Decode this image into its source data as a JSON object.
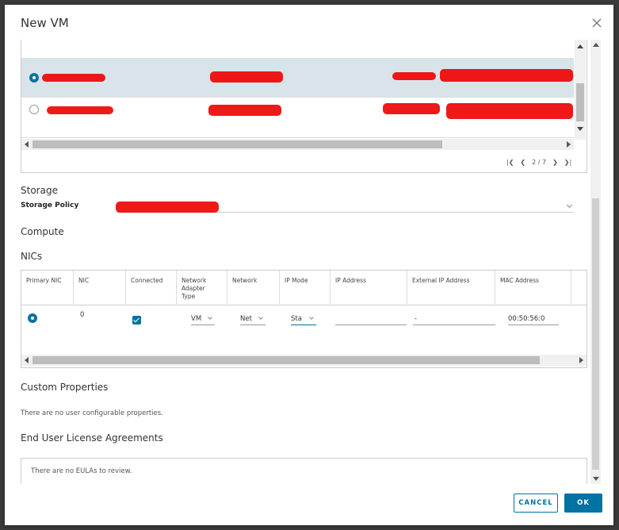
{
  "dialog": {
    "title": "New VM"
  },
  "image_grid": {
    "rows": [
      {
        "selected": true
      },
      {
        "selected": false
      }
    ],
    "pager": {
      "page": "2 / 7"
    }
  },
  "storage": {
    "title": "Storage",
    "policy_label": "Storage Policy"
  },
  "compute": {
    "title": "Compute"
  },
  "nics": {
    "title": "NICs",
    "columns": [
      "Primary NIC",
      "NIC",
      "Connected",
      "Network Adapter Type",
      "Network",
      "IP Mode",
      "IP Address",
      "External IP Address",
      "MAC Address"
    ],
    "rows": [
      {
        "nic": "0",
        "adapter_type": "VM",
        "network": "Net",
        "ip_mode": "Sta",
        "ip_address": "",
        "external_ip": "-",
        "mac": "00:50:56:0"
      }
    ]
  },
  "custom_properties": {
    "title": "Custom Properties",
    "empty_text": "There are no user configurable properties."
  },
  "eula": {
    "title": "End User License Agreements",
    "empty_text": "There are no EULAs to review."
  },
  "footer": {
    "cancel_label": "CANCEL",
    "ok_label": "OK"
  },
  "colors": {
    "accent": "#0072a3",
    "selected_row": "#d9e4ea"
  }
}
